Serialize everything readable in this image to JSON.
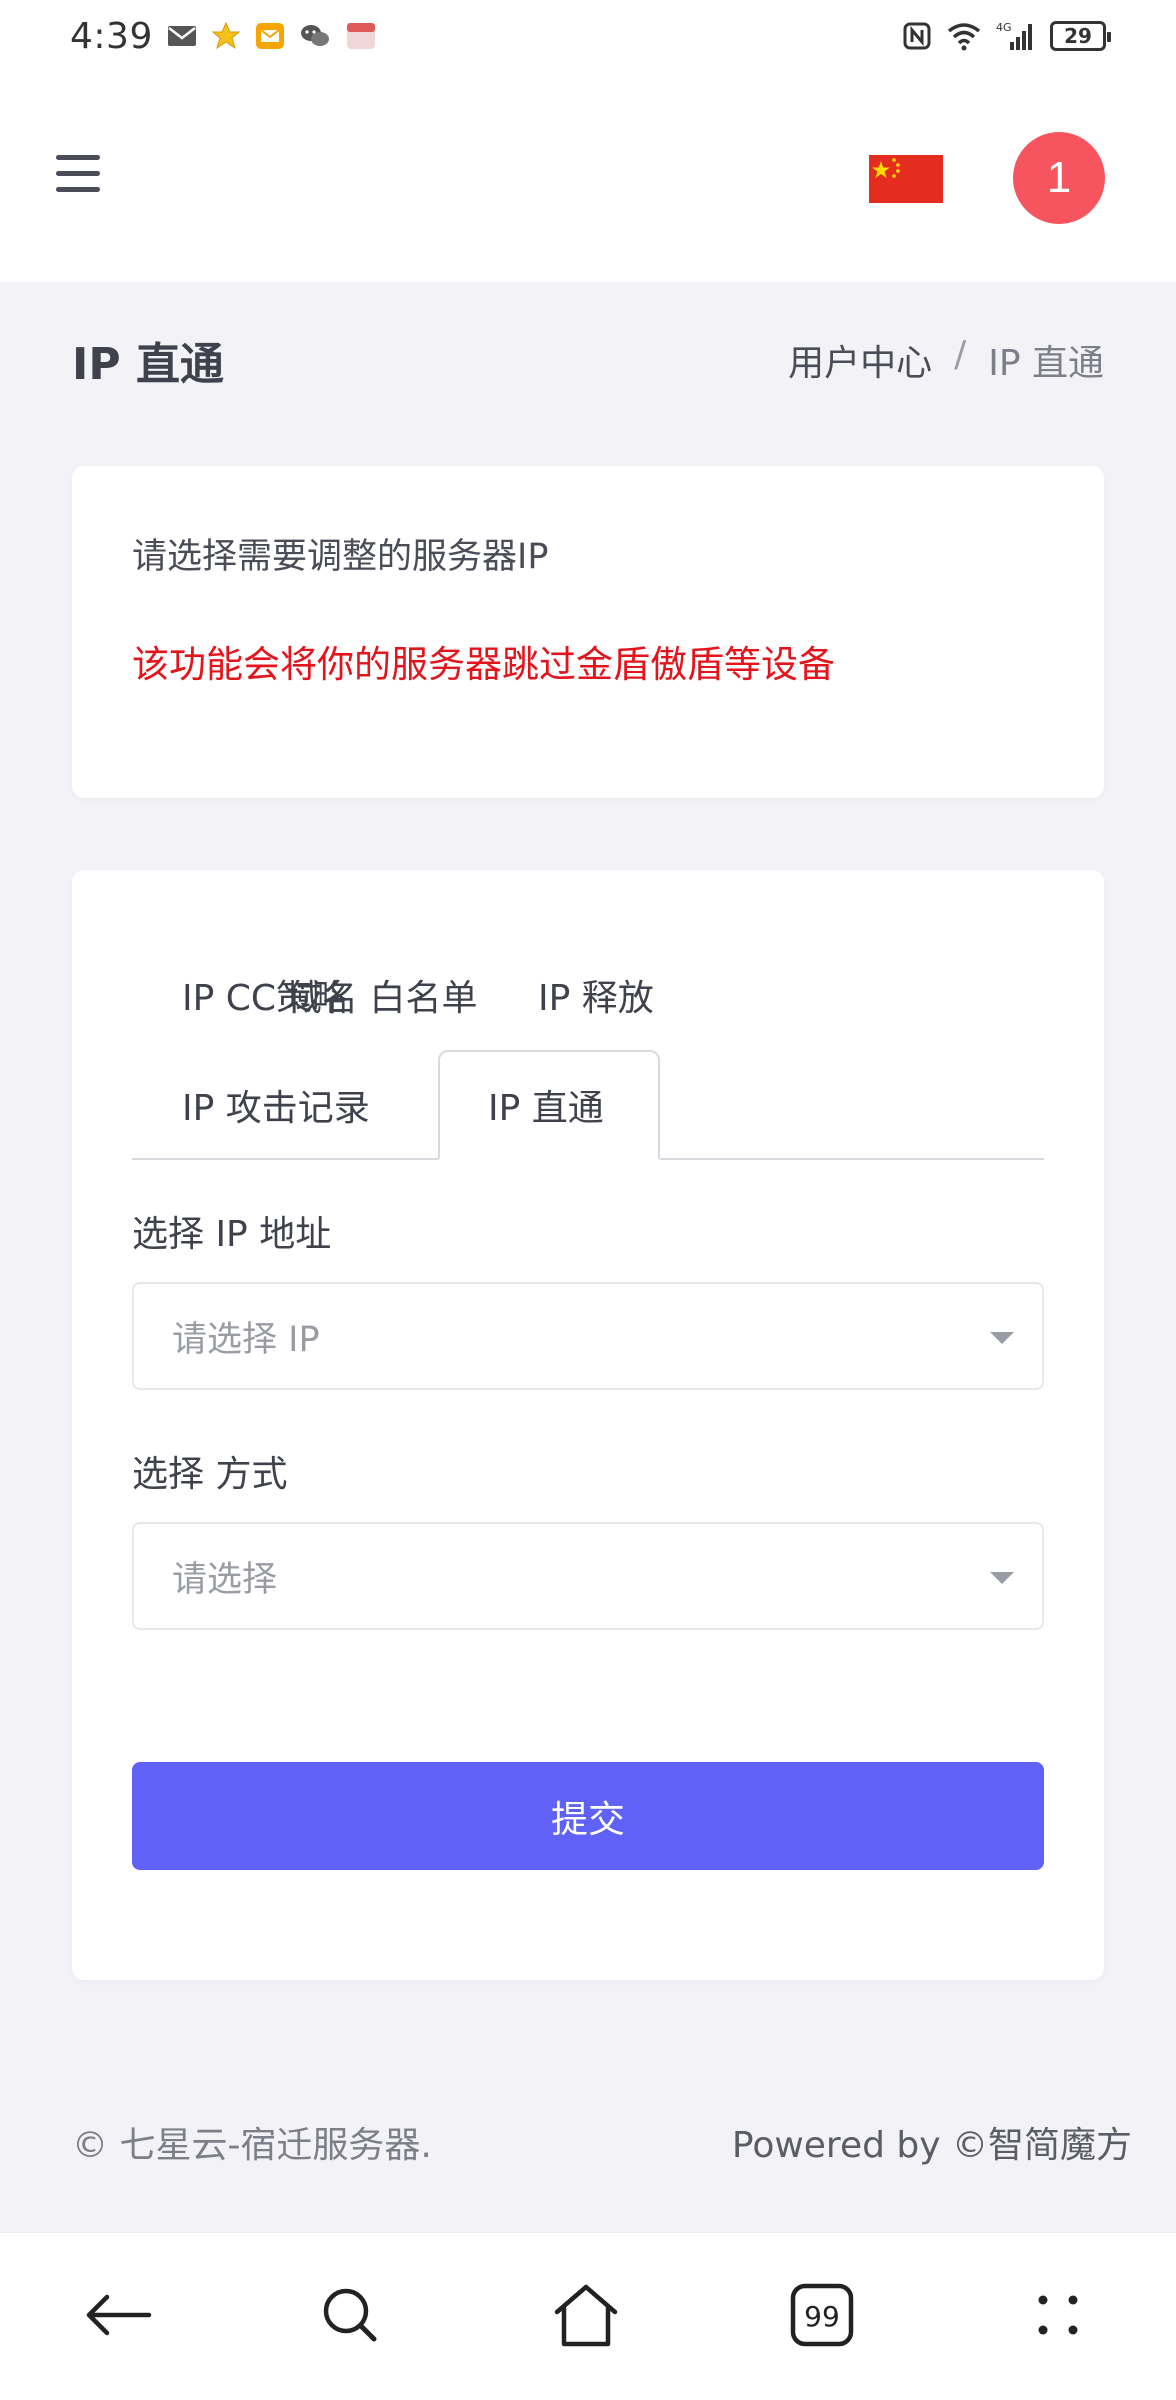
{
  "status": {
    "time": "4:39",
    "battery": "29",
    "network": "4G"
  },
  "header": {
    "avatar_label": "1",
    "flag": "china-flag"
  },
  "page": {
    "title": "IP 直通",
    "breadcrumb": {
      "parent": "用户中心",
      "separator": "/",
      "current": "IP 直通"
    }
  },
  "notice": {
    "instruction": "请选择需要调整的服务器IP",
    "warning": "该功能会将你的服务器跳过金盾傲盾等设备"
  },
  "tabs": [
    {
      "label": "IP CC策略"
    },
    {
      "label": "域名 白名单"
    },
    {
      "label": "IP 释放"
    },
    {
      "label": "IP 攻击记录"
    },
    {
      "label": "IP 直通"
    }
  ],
  "form": {
    "ip_label": "选择 IP 地址",
    "ip_placeholder": "请选择 IP",
    "mode_label": "选择 方式",
    "mode_placeholder": "请选择",
    "submit_label": "提交"
  },
  "footer": {
    "copyright": "© 七星云-宿迁服务器.",
    "powered": "Powered by ©智简魔方"
  },
  "colors": {
    "accent": "#5f61f7",
    "warning": "#e3141c",
    "avatar": "#f6555f"
  }
}
